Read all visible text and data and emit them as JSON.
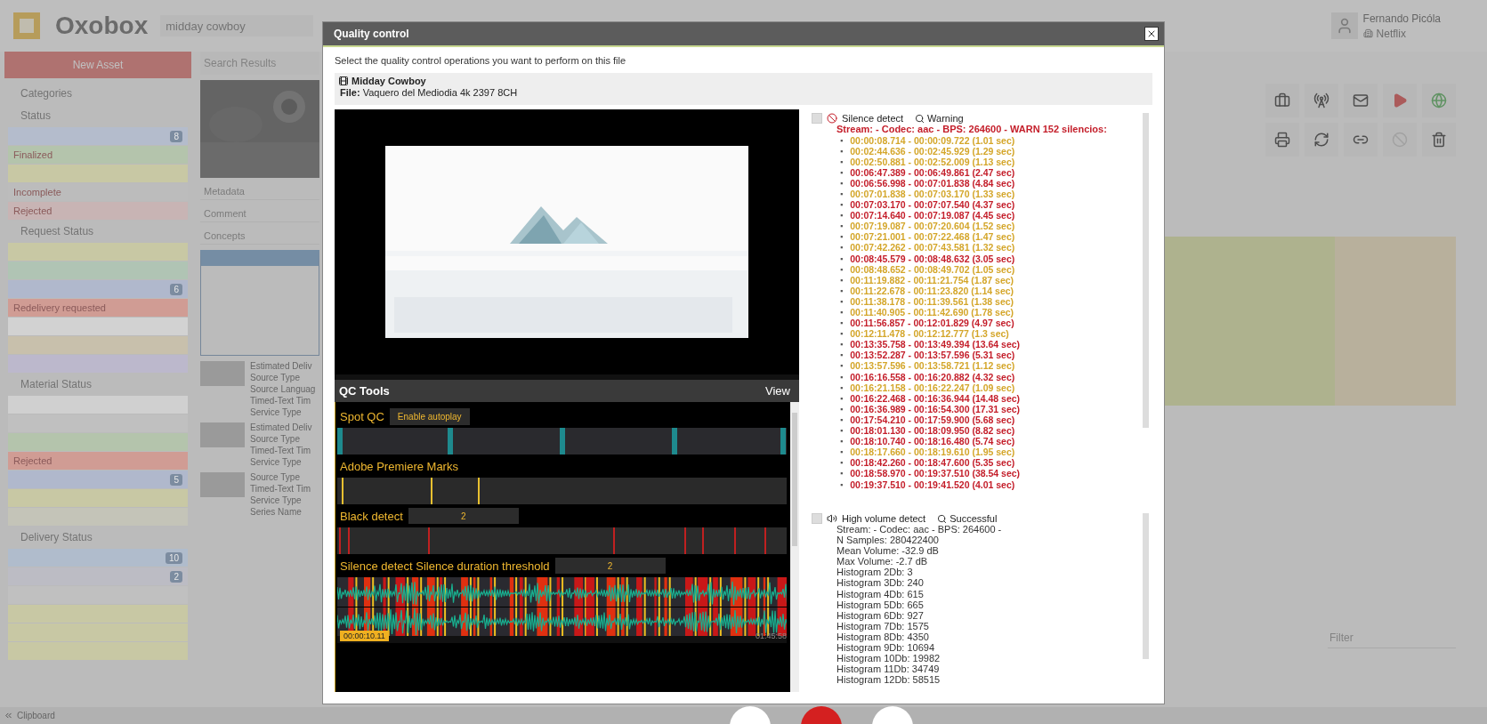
{
  "header": {
    "logo": "Oxobox",
    "search": {
      "value": "midday cowboy"
    },
    "user": {
      "name": "Fernando Picóla",
      "company": "Netflix"
    }
  },
  "sidebar": {
    "new_button": "New Asset",
    "categories": "Categories",
    "sections": [
      {
        "title": "Status",
        "items": [
          {
            "color": "#b4bccc",
            "count": "8"
          },
          {
            "label": "Finalized",
            "color": "#b4c4ac"
          },
          {
            "color": "#c8c8a4"
          },
          {
            "label": "Incomplete",
            "color": "#bcbcbc"
          },
          {
            "label": "Rejected",
            "color": "#c8b4b4"
          }
        ]
      },
      {
        "title": "Request Status",
        "items": [
          {
            "color": "#c8c8a4"
          },
          {
            "color": "#b0c4b4"
          },
          {
            "color": "#b0b8cc",
            "count": "6"
          },
          {
            "label": "Redelivery requested",
            "color": "#d09c94"
          },
          {
            "color": "#d2d2d2"
          },
          {
            "color": "#c8c0ac"
          },
          {
            "color": "#bcb8cc"
          }
        ]
      },
      {
        "title": "Material Status",
        "items": [
          {
            "color": "#d0d0d0"
          },
          {
            "color": "#c0c0c0"
          },
          {
            "color": "#b4c4ac"
          },
          {
            "label": "Rejected",
            "color": "#d09c94"
          },
          {
            "color": "#b0b8cc",
            "count": "5"
          },
          {
            "color": "#c8c8a4"
          },
          {
            "color": "#c4c4b8"
          }
        ]
      },
      {
        "title": "Delivery Status",
        "items": [
          {
            "color": "#b0bccc",
            "count": "10"
          },
          {
            "color": "#bcbcc4",
            "count": "2"
          },
          {
            "color": "#c0c0c0"
          },
          {
            "color": "#c8c8a4"
          },
          {
            "color": "#c8c8a4"
          },
          {
            "color": "#c8c8a4"
          }
        ]
      }
    ]
  },
  "results": {
    "title": "Search Results",
    "metadata": [
      "Metadata",
      "Comment",
      "Concepts"
    ],
    "items": [
      {
        "lines": [
          "Estimated Deliv",
          "Source Type",
          "Source Languag",
          "Timed-Text Tim",
          "Service Type"
        ]
      },
      {
        "lines": [
          "Estimated Deliv",
          "Source Type",
          "Timed-Text Tim",
          "Service Type"
        ]
      },
      {
        "lines": [
          "Source Type",
          "Timed-Text Tim",
          "Service Type",
          "Series Name"
        ]
      }
    ]
  },
  "filter": {
    "placeholder": "Filter"
  },
  "clipboard": "Clipboard",
  "dialog": {
    "title": "Quality control",
    "intro": "Select the quality control operations you want to perform on this file",
    "file": {
      "name": "Midday Cowboy",
      "path": "**File:** Vaquero del Mediodia 4k 2397 8CH"
    },
    "qc_tools": {
      "title": "QC Tools",
      "view": "View",
      "tracks": [
        {
          "kind": "spot",
          "label": "Spot QC",
          "button": "Enable autoplay"
        },
        {
          "kind": "marks",
          "label": "Adobe Premiere Marks"
        },
        {
          "kind": "black",
          "label": "Black detect",
          "value": "2"
        },
        {
          "kind": "silence",
          "label": "Silence detect Silence duration threshold",
          "value": "2",
          "start_time": "00:00:10.11",
          "end_time": "01:45:58"
        }
      ]
    },
    "checks": [
      {
        "kind": "silence",
        "label": "Silence detect",
        "status": "Warning",
        "checked": false,
        "summary": "Stream: - Codec: aac - BPS: 264600 - WARN 152 silencios:",
        "bullet": "▪",
        "entries": [
          {
            "text": "00:00:08.714 - 00:00:09.722 (1.01 sec)",
            "color": "#d4a62a"
          },
          {
            "text": "00:02:44.636 - 00:02:45.929 (1.29 sec)",
            "color": "#d4a62a"
          },
          {
            "text": "00:02:50.881 - 00:02:52.009 (1.13 sec)",
            "color": "#d4a62a"
          },
          {
            "text": "00:06:47.389 - 00:06:49.861 (2.47 sec)",
            "color": "#c41e2a"
          },
          {
            "text": "00:06:56.998 - 00:07:01.838 (4.84 sec)",
            "color": "#c41e2a"
          },
          {
            "text": "00:07:01.838 - 00:07:03.170 (1.33 sec)",
            "color": "#d4a62a"
          },
          {
            "text": "00:07:03.170 - 00:07:07.540 (4.37 sec)",
            "color": "#c41e2a"
          },
          {
            "text": "00:07:14.640 - 00:07:19.087 (4.45 sec)",
            "color": "#c41e2a"
          },
          {
            "text": "00:07:19.087 - 00:07:20.604 (1.52 sec)",
            "color": "#d4a62a"
          },
          {
            "text": "00:07:21.001 - 00:07:22.468 (1.47 sec)",
            "color": "#d4a62a"
          },
          {
            "text": "00:07:42.262 - 00:07:43.581 (1.32 sec)",
            "color": "#d4a62a"
          },
          {
            "text": "00:08:45.579 - 00:08:48.632 (3.05 sec)",
            "color": "#c41e2a"
          },
          {
            "text": "00:08:48.652 - 00:08:49.702 (1.05 sec)",
            "color": "#d4a62a"
          },
          {
            "text": "00:11:19.882 - 00:11:21.754 (1.87 sec)",
            "color": "#d4a62a"
          },
          {
            "text": "00:11:22.678 - 00:11:23.820 (1.14 sec)",
            "color": "#d4a62a"
          },
          {
            "text": "00:11:38.178 - 00:11:39.561 (1.38 sec)",
            "color": "#d4a62a"
          },
          {
            "text": "00:11:40.905 - 00:11:42.690 (1.78 sec)",
            "color": "#d4a62a"
          },
          {
            "text": "00:11:56.857 - 00:12:01.829 (4.97 sec)",
            "color": "#c41e2a"
          },
          {
            "text": "00:12:11.478 - 00:12:12.777 (1.3 sec)",
            "color": "#d4a62a"
          },
          {
            "text": "00:13:35.758 - 00:13:49.394 (13.64 sec)",
            "color": "#c41e2a"
          },
          {
            "text": "00:13:52.287 - 00:13:57.596 (5.31 sec)",
            "color": "#c41e2a"
          },
          {
            "text": "00:13:57.596 - 00:13:58.721 (1.12 sec)",
            "color": "#d4a62a"
          },
          {
            "text": "00:16:16.558 - 00:16:20.882 (4.32 sec)",
            "color": "#c41e2a"
          },
          {
            "text": "00:16:21.158 - 00:16:22.247 (1.09 sec)",
            "color": "#d4a62a"
          },
          {
            "text": "00:16:22.468 - 00:16:36.944 (14.48 sec)",
            "color": "#c41e2a"
          },
          {
            "text": "00:16:36.989 - 00:16:54.300 (17.31 sec)",
            "color": "#c41e2a"
          },
          {
            "text": "00:17:54.210 - 00:17:59.900 (5.68 sec)",
            "color": "#c41e2a"
          },
          {
            "text": "00:18:01.130 - 00:18:09.950 (8.82 sec)",
            "color": "#c41e2a"
          },
          {
            "text": "00:18:10.740 - 00:18:16.480 (5.74 sec)",
            "color": "#c41e2a"
          },
          {
            "text": "00:18:17.660 - 00:18:19.610 (1.95 sec)",
            "color": "#d4a62a"
          },
          {
            "text": "00:18:42.260 - 00:18:47.600 (5.35 sec)",
            "color": "#c41e2a"
          },
          {
            "text": "00:18:58.970 - 00:19:37.510 (38.54 sec)",
            "color": "#c41e2a"
          },
          {
            "text": "00:19:37.510 - 00:19:41.520 (4.01 sec)",
            "color": "#c41e2a"
          }
        ]
      },
      {
        "kind": "volume",
        "label": "High volume detect",
        "status": "Successful",
        "checked": false,
        "lines": [
          "Stream: - Codec: aac - BPS: 264600 -",
          "N Samples: 280422400",
          "Mean Volume: -32.9 dB",
          "Max Volume: -2.7 dB",
          "Histogram 2Db: 3",
          "Histogram 3Db: 240",
          "Histogram 4Db: 615",
          "Histogram 5Db: 665",
          "Histogram 6Db: 927",
          "Histogram 7Db: 1575",
          "Histogram 8Db: 4350",
          "Histogram 9Db: 10694",
          "Histogram 10Db: 19982",
          "Histogram 11Db: 34749",
          "Histogram 12Db: 58515"
        ]
      }
    ]
  }
}
